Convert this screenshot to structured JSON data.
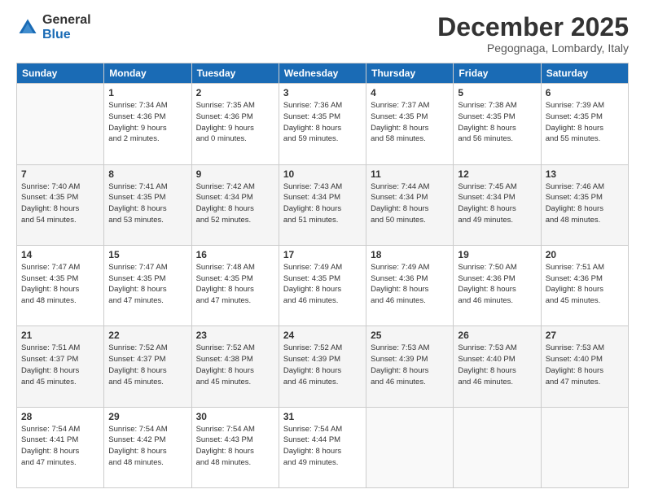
{
  "logo": {
    "general": "General",
    "blue": "Blue"
  },
  "header": {
    "month": "December 2025",
    "location": "Pegognaga, Lombardy, Italy"
  },
  "weekdays": [
    "Sunday",
    "Monday",
    "Tuesday",
    "Wednesday",
    "Thursday",
    "Friday",
    "Saturday"
  ],
  "weeks": [
    [
      {
        "day": "",
        "info": ""
      },
      {
        "day": "1",
        "info": "Sunrise: 7:34 AM\nSunset: 4:36 PM\nDaylight: 9 hours\nand 2 minutes."
      },
      {
        "day": "2",
        "info": "Sunrise: 7:35 AM\nSunset: 4:36 PM\nDaylight: 9 hours\nand 0 minutes."
      },
      {
        "day": "3",
        "info": "Sunrise: 7:36 AM\nSunset: 4:35 PM\nDaylight: 8 hours\nand 59 minutes."
      },
      {
        "day": "4",
        "info": "Sunrise: 7:37 AM\nSunset: 4:35 PM\nDaylight: 8 hours\nand 58 minutes."
      },
      {
        "day": "5",
        "info": "Sunrise: 7:38 AM\nSunset: 4:35 PM\nDaylight: 8 hours\nand 56 minutes."
      },
      {
        "day": "6",
        "info": "Sunrise: 7:39 AM\nSunset: 4:35 PM\nDaylight: 8 hours\nand 55 minutes."
      }
    ],
    [
      {
        "day": "7",
        "info": "Sunrise: 7:40 AM\nSunset: 4:35 PM\nDaylight: 8 hours\nand 54 minutes."
      },
      {
        "day": "8",
        "info": "Sunrise: 7:41 AM\nSunset: 4:35 PM\nDaylight: 8 hours\nand 53 minutes."
      },
      {
        "day": "9",
        "info": "Sunrise: 7:42 AM\nSunset: 4:34 PM\nDaylight: 8 hours\nand 52 minutes."
      },
      {
        "day": "10",
        "info": "Sunrise: 7:43 AM\nSunset: 4:34 PM\nDaylight: 8 hours\nand 51 minutes."
      },
      {
        "day": "11",
        "info": "Sunrise: 7:44 AM\nSunset: 4:34 PM\nDaylight: 8 hours\nand 50 minutes."
      },
      {
        "day": "12",
        "info": "Sunrise: 7:45 AM\nSunset: 4:34 PM\nDaylight: 8 hours\nand 49 minutes."
      },
      {
        "day": "13",
        "info": "Sunrise: 7:46 AM\nSunset: 4:35 PM\nDaylight: 8 hours\nand 48 minutes."
      }
    ],
    [
      {
        "day": "14",
        "info": "Sunrise: 7:47 AM\nSunset: 4:35 PM\nDaylight: 8 hours\nand 48 minutes."
      },
      {
        "day": "15",
        "info": "Sunrise: 7:47 AM\nSunset: 4:35 PM\nDaylight: 8 hours\nand 47 minutes."
      },
      {
        "day": "16",
        "info": "Sunrise: 7:48 AM\nSunset: 4:35 PM\nDaylight: 8 hours\nand 47 minutes."
      },
      {
        "day": "17",
        "info": "Sunrise: 7:49 AM\nSunset: 4:35 PM\nDaylight: 8 hours\nand 46 minutes."
      },
      {
        "day": "18",
        "info": "Sunrise: 7:49 AM\nSunset: 4:36 PM\nDaylight: 8 hours\nand 46 minutes."
      },
      {
        "day": "19",
        "info": "Sunrise: 7:50 AM\nSunset: 4:36 PM\nDaylight: 8 hours\nand 46 minutes."
      },
      {
        "day": "20",
        "info": "Sunrise: 7:51 AM\nSunset: 4:36 PM\nDaylight: 8 hours\nand 45 minutes."
      }
    ],
    [
      {
        "day": "21",
        "info": "Sunrise: 7:51 AM\nSunset: 4:37 PM\nDaylight: 8 hours\nand 45 minutes."
      },
      {
        "day": "22",
        "info": "Sunrise: 7:52 AM\nSunset: 4:37 PM\nDaylight: 8 hours\nand 45 minutes."
      },
      {
        "day": "23",
        "info": "Sunrise: 7:52 AM\nSunset: 4:38 PM\nDaylight: 8 hours\nand 45 minutes."
      },
      {
        "day": "24",
        "info": "Sunrise: 7:52 AM\nSunset: 4:39 PM\nDaylight: 8 hours\nand 46 minutes."
      },
      {
        "day": "25",
        "info": "Sunrise: 7:53 AM\nSunset: 4:39 PM\nDaylight: 8 hours\nand 46 minutes."
      },
      {
        "day": "26",
        "info": "Sunrise: 7:53 AM\nSunset: 4:40 PM\nDaylight: 8 hours\nand 46 minutes."
      },
      {
        "day": "27",
        "info": "Sunrise: 7:53 AM\nSunset: 4:40 PM\nDaylight: 8 hours\nand 47 minutes."
      }
    ],
    [
      {
        "day": "28",
        "info": "Sunrise: 7:54 AM\nSunset: 4:41 PM\nDaylight: 8 hours\nand 47 minutes."
      },
      {
        "day": "29",
        "info": "Sunrise: 7:54 AM\nSunset: 4:42 PM\nDaylight: 8 hours\nand 48 minutes."
      },
      {
        "day": "30",
        "info": "Sunrise: 7:54 AM\nSunset: 4:43 PM\nDaylight: 8 hours\nand 48 minutes."
      },
      {
        "day": "31",
        "info": "Sunrise: 7:54 AM\nSunset: 4:44 PM\nDaylight: 8 hours\nand 49 minutes."
      },
      {
        "day": "",
        "info": ""
      },
      {
        "day": "",
        "info": ""
      },
      {
        "day": "",
        "info": ""
      }
    ]
  ]
}
